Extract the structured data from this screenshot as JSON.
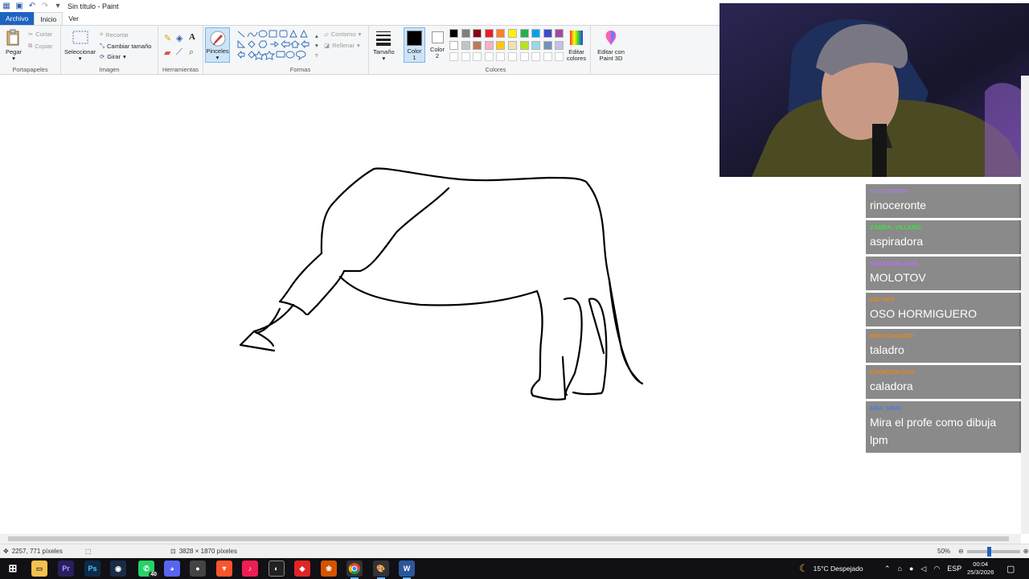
{
  "window": {
    "title": "Sin título - Paint"
  },
  "menu": {
    "tabs": [
      "Archivo",
      "Inicio",
      "Ver"
    ]
  },
  "ribbon": {
    "portapapeles": {
      "label": "Portapapeles",
      "paste": "Pegar",
      "cut": "Cortar",
      "copy": "Copiar"
    },
    "imagen": {
      "label": "Imagen",
      "select": "Seleccionar",
      "crop": "Recortar",
      "resize": "Cambiar tamaño",
      "rotate": "Girar"
    },
    "herramientas": {
      "label": "Herramientas"
    },
    "brushes": "Pinceles",
    "formas": {
      "label": "Formas",
      "outline": "Contorno",
      "fill": "Rellenar"
    },
    "size": "Tamaño",
    "color1_line1": "Color",
    "color1_line2": "1",
    "color2_line1": "Color",
    "color2_line2": "2",
    "colores": {
      "label": "Colores",
      "edit_line1": "Editar",
      "edit_line2": "colores",
      "paint3d_line1": "Editar con",
      "paint3d_line2": "Paint 3D"
    },
    "palette": [
      "#000000",
      "#7f7f7f",
      "#880015",
      "#ed1c24",
      "#ff7f27",
      "#fff200",
      "#22b14c",
      "#00a2e8",
      "#3f48cc",
      "#a349a4",
      "#ffffff",
      "#c3c3c3",
      "#b97a57",
      "#ffaec9",
      "#ffc90e",
      "#efe4b0",
      "#b5e61d",
      "#99d9ea",
      "#7092be",
      "#c8bfe7"
    ],
    "color1_value": "#000000",
    "color2_value": "#ffffff"
  },
  "chat": [
    {
      "user": "GASTONHDP",
      "color": "#a77fd6",
      "text": "rinoceronte"
    },
    {
      "user": "ZAMBA_VILLERO",
      "color": "#3fe03f",
      "text": "aspiradora"
    },
    {
      "user": "MALEEGALASSI",
      "color": "#c06bff",
      "text": "MOLOTOV"
    },
    {
      "user": "CECYPY",
      "color": "#e8861c",
      "text": "OSO HORMIGUERO"
    },
    {
      "user": "BRKVCHOUDD",
      "color": "#e8861c",
      "text": "taladro"
    },
    {
      "user": "CHORIZOLOCO",
      "color": "#e8861c",
      "text": "caladora"
    },
    {
      "user": "EMA_BRAI",
      "color": "#4a7dd6",
      "text": "Mira el profe como dibuja lpm"
    }
  ],
  "status": {
    "cursor": "2257, 771 píxeles",
    "canvas_size": "3828 × 1870 píxeles",
    "zoom": "50%"
  },
  "taskbar": {
    "whatsapp_badge": "40",
    "weather": "15°C  Despejado",
    "lang": "ESP",
    "time": "00:04",
    "date": "25/3/2026"
  }
}
